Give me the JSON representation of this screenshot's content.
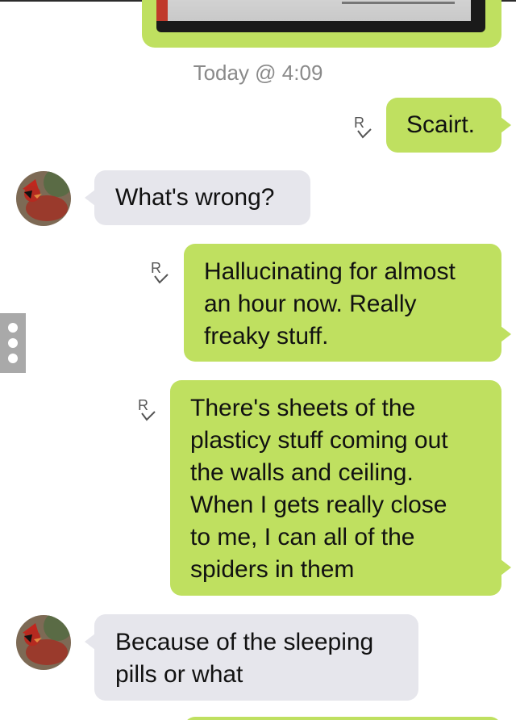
{
  "conversation": {
    "timestamp": "Today @ 4:09",
    "messages": [
      {
        "id": "m1",
        "direction": "sent",
        "text": "Scairt.",
        "receipt": "R✓"
      },
      {
        "id": "m2",
        "direction": "received",
        "text": "What's wrong?"
      },
      {
        "id": "m3",
        "direction": "sent",
        "text": "Hallucinating for almost\nan hour now.  Really\nfreaky stuff.",
        "receipt": "R✓"
      },
      {
        "id": "m4",
        "direction": "sent",
        "text": "There's sheets of the\nplasticy stuff coming out\nthe walls and ceiling.\nWhen I gets really close\nto me, I can all of the\nspiders in them",
        "receipt": "R✓"
      },
      {
        "id": "m5",
        "direction": "received",
        "text": "Because of the sleeping\npills or what"
      }
    ]
  },
  "colors": {
    "sent_bubble": "#bfe060",
    "received_bubble": "#e6e6ec",
    "timestamp_text": "#8a8a8a",
    "side_handle": "#a9a9a9"
  },
  "icons": {
    "receipt": "read-receipt-icon",
    "avatar": "cardinal-avatar",
    "side_handle": "more-options-icon"
  }
}
